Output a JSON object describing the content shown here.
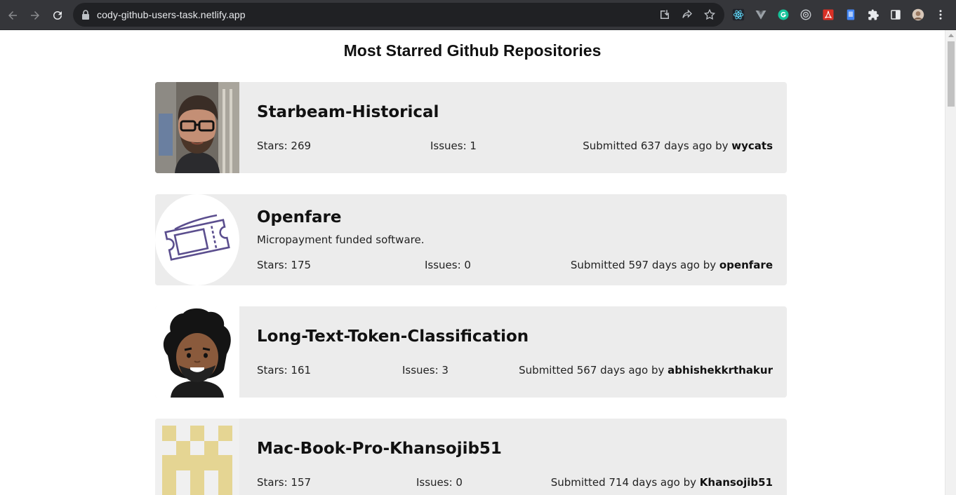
{
  "browser": {
    "url": "cody-github-users-task.netlify.app"
  },
  "page": {
    "title": "Most Starred Github Repositories",
    "stars_prefix": "Stars: ",
    "issues_prefix": "Issues: ",
    "submitted_prefix": "Submitted ",
    "submitted_middle": " days ago by "
  },
  "repos": [
    {
      "name": "Starbeam-Historical",
      "description": "",
      "stars": "Stars: 269",
      "issues": "Issues: 1",
      "submitted": "Submitted 637 days ago by ",
      "owner": "wycats",
      "avatar": "photo-man-glasses"
    },
    {
      "name": "Openfare",
      "description": "Micropayment funded software.",
      "stars": "Stars: 175",
      "issues": "Issues: 0",
      "submitted": "Submitted 597 days ago by ",
      "owner": "openfare",
      "avatar": "ticket-icon"
    },
    {
      "name": "Long-Text-Token-Classification",
      "description": "",
      "stars": "Stars: 161",
      "issues": "Issues: 3",
      "submitted": "Submitted 567 days ago by ",
      "owner": "abhishekkrthakur",
      "avatar": "cartoon-man-avatar"
    },
    {
      "name": "Mac-Book-Pro-Khansojib51",
      "description": "",
      "stars": "Stars: 157",
      "issues": "Issues: 0",
      "submitted": "Submitted 714 days ago by ",
      "owner": "Khansojib51",
      "avatar": "identicon"
    }
  ],
  "colors": {
    "card_bg": "#ececec",
    "chrome_bg": "#35363a",
    "omnibox_bg": "#202124",
    "identicon": "#e5d593"
  }
}
